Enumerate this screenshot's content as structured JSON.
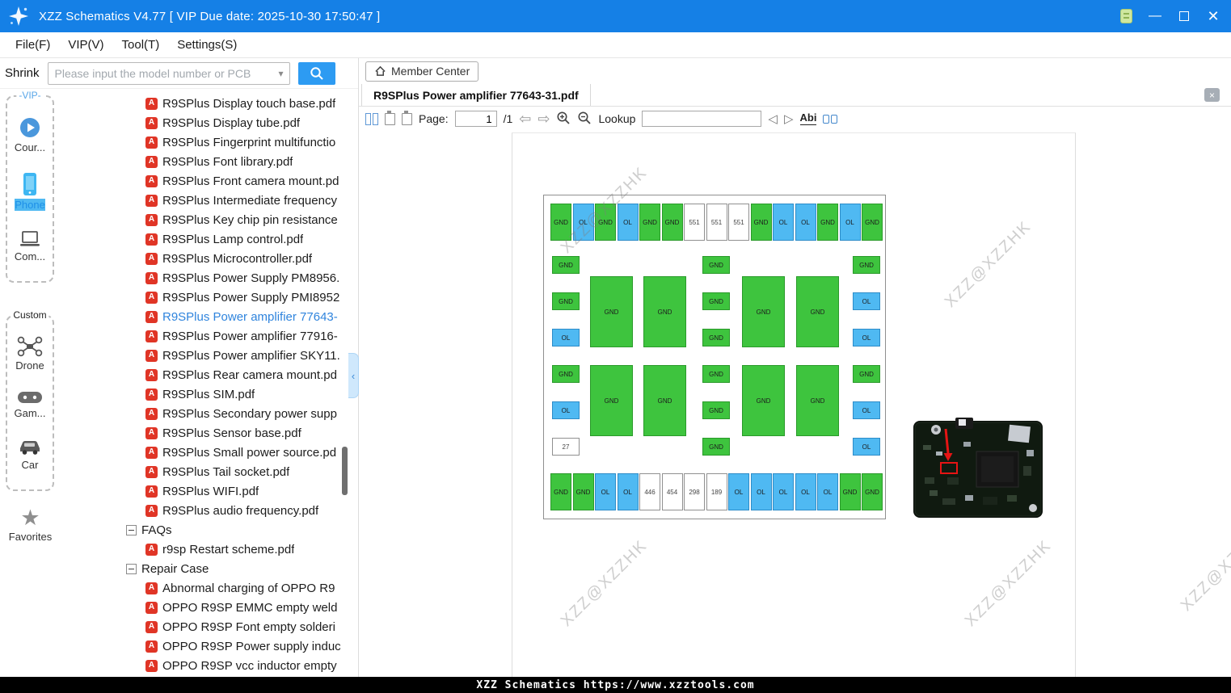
{
  "titlebar": {
    "title": "XZZ Schematics V4.77 [ VIP Due date: 2025-10-30 17:50:47 ]"
  },
  "menu": {
    "items": [
      {
        "label": "File(F)"
      },
      {
        "label": "VIP(V)"
      },
      {
        "label": "Tool(T)"
      },
      {
        "label": "Settings(S)"
      }
    ]
  },
  "toolbar": {
    "shrink_label": "Shrink",
    "search_placeholder": "Please input the model number or PCB"
  },
  "sidebar": {
    "vip_title": "-VIP-",
    "vip_items": [
      {
        "label": "Cour...",
        "icon": "play-circle-icon"
      },
      {
        "label": "Phone",
        "icon": "phone-icon"
      },
      {
        "label": "Com...",
        "icon": "computer-icon"
      }
    ],
    "custom_title": "Custom",
    "custom_items": [
      {
        "label": "Drone",
        "icon": "drone-icon"
      },
      {
        "label": "Gam...",
        "icon": "gamepad-icon"
      },
      {
        "label": "Car",
        "icon": "car-icon"
      }
    ],
    "favorites_label": "Favorites"
  },
  "tree": {
    "files": [
      {
        "label": "R9SPlus Display touch base.pdf"
      },
      {
        "label": "R9SPlus Display tube.pdf"
      },
      {
        "label": "R9SPlus Fingerprint multifunctio"
      },
      {
        "label": "R9SPlus Font library.pdf"
      },
      {
        "label": "R9SPlus Front camera mount.pd"
      },
      {
        "label": "R9SPlus Intermediate frequency"
      },
      {
        "label": "R9SPlus Key chip pin resistance"
      },
      {
        "label": "R9SPlus Lamp control.pdf"
      },
      {
        "label": "R9SPlus Microcontroller.pdf"
      },
      {
        "label": "R9SPlus Power Supply PM8956."
      },
      {
        "label": "R9SPlus Power Supply PMI8952"
      },
      {
        "label": "R9SPlus Power amplifier 77643-",
        "selected": true
      },
      {
        "label": "R9SPlus Power amplifier 77916-"
      },
      {
        "label": "R9SPlus Power amplifier SKY11."
      },
      {
        "label": "R9SPlus Rear camera mount.pd"
      },
      {
        "label": "R9SPlus SIM.pdf"
      },
      {
        "label": "R9SPlus Secondary power supp"
      },
      {
        "label": "R9SPlus Sensor base.pdf"
      },
      {
        "label": "R9SPlus Small power source.pd"
      },
      {
        "label": "R9SPlus Tail socket.pdf"
      },
      {
        "label": "R9SPlus WIFI.pdf"
      },
      {
        "label": "R9SPlus audio frequency.pdf"
      }
    ],
    "faqs": {
      "label": "FAQs",
      "children": [
        {
          "label": "r9sp Restart scheme.pdf"
        }
      ]
    },
    "repair": {
      "label": "Repair Case",
      "children": [
        {
          "label": "Abnormal charging of OPPO R9"
        },
        {
          "label": "OPPO R9SP EMMC empty weld"
        },
        {
          "label": "OPPO R9SP Font empty solderi"
        },
        {
          "label": "OPPO R9SP Power supply induc"
        },
        {
          "label": "OPPO R9SP vcc inductor empty"
        }
      ]
    }
  },
  "content": {
    "member_center_label": "Member Center",
    "tab_label": "R9SPlus Power amplifier 77643-31.pdf",
    "watermark": "XZZ@XZZHK"
  },
  "pdf_toolbar": {
    "page_label": "Page:",
    "page_value": "1",
    "page_total": "/1",
    "lookup_label": "Lookup",
    "abi_label": "Abi"
  },
  "icons": {
    "pdf_glyph": "A",
    "chevron_down": "▾",
    "close": "×",
    "minimize": "—",
    "back_arrow": "⇦",
    "forward_arrow": "⇨",
    "tri_left": "◁",
    "tri_right": "▷",
    "collapse_chevron": "‹"
  },
  "diagram": {
    "top_row": [
      {
        "label": "GND",
        "type": "green"
      },
      {
        "label": "OL",
        "type": "blue"
      },
      {
        "label": "GND",
        "type": "green"
      },
      {
        "label": "OL",
        "type": "blue"
      },
      {
        "label": "GND",
        "type": "green"
      },
      {
        "label": "GND",
        "type": "green"
      },
      {
        "label": "551",
        "type": "white"
      },
      {
        "label": "551",
        "type": "white"
      },
      {
        "label": "551",
        "type": "white"
      },
      {
        "label": "GND",
        "type": "green"
      },
      {
        "label": "OL",
        "type": "blue"
      },
      {
        "label": "OL",
        "type": "blue"
      },
      {
        "label": "GND",
        "type": "green"
      },
      {
        "label": "OL",
        "type": "blue"
      },
      {
        "label": "GND",
        "type": "green"
      }
    ],
    "bottom_row": [
      {
        "label": "GND",
        "type": "green"
      },
      {
        "label": "GND",
        "type": "green"
      },
      {
        "label": "OL",
        "type": "blue"
      },
      {
        "label": "OL",
        "type": "blue"
      },
      {
        "label": "446",
        "type": "white"
      },
      {
        "label": "454",
        "type": "white"
      },
      {
        "label": "298",
        "type": "white"
      },
      {
        "label": "189",
        "type": "white"
      },
      {
        "label": "OL",
        "type": "blue"
      },
      {
        "label": "OL",
        "type": "blue"
      },
      {
        "label": "OL",
        "type": "blue"
      },
      {
        "label": "OL",
        "type": "blue"
      },
      {
        "label": "OL",
        "type": "blue"
      },
      {
        "label": "GND",
        "type": "green"
      },
      {
        "label": "GND",
        "type": "green"
      }
    ],
    "left_col": [
      {
        "label": "GND",
        "type": "green"
      },
      {
        "label": "GND",
        "type": "green"
      },
      {
        "label": "OL",
        "type": "blue"
      },
      {
        "label": "GND",
        "type": "green"
      },
      {
        "label": "OL",
        "type": "blue"
      },
      {
        "label": "27",
        "type": "white"
      }
    ],
    "mid_col": [
      {
        "label": "GND",
        "type": "green"
      },
      {
        "label": "GND",
        "type": "green"
      },
      {
        "label": "GND",
        "type": "green"
      },
      {
        "label": "GND",
        "type": "green"
      },
      {
        "label": "GND",
        "type": "green"
      },
      {
        "label": "GND",
        "type": "green"
      }
    ],
    "right_col": [
      {
        "label": "GND",
        "type": "green"
      },
      {
        "label": "OL",
        "type": "blue"
      },
      {
        "label": "OL",
        "type": "blue"
      },
      {
        "label": "GND",
        "type": "green"
      },
      {
        "label": "OL",
        "type": "blue"
      },
      {
        "label": "OL",
        "type": "blue"
      }
    ],
    "blocks": [
      {
        "label": "GND",
        "pos": "r1c1"
      },
      {
        "label": "GND",
        "pos": "r1c2"
      },
      {
        "label": "GND",
        "pos": "r1c3"
      },
      {
        "label": "GND",
        "pos": "r1c4"
      },
      {
        "label": "GND",
        "pos": "r2c1"
      },
      {
        "label": "GND",
        "pos": "r2c2"
      },
      {
        "label": "GND",
        "pos": "r2c3"
      },
      {
        "label": "GND",
        "pos": "r2c4"
      }
    ]
  },
  "statusbar": {
    "text": "XZZ Schematics https://www.xzztools.com"
  }
}
